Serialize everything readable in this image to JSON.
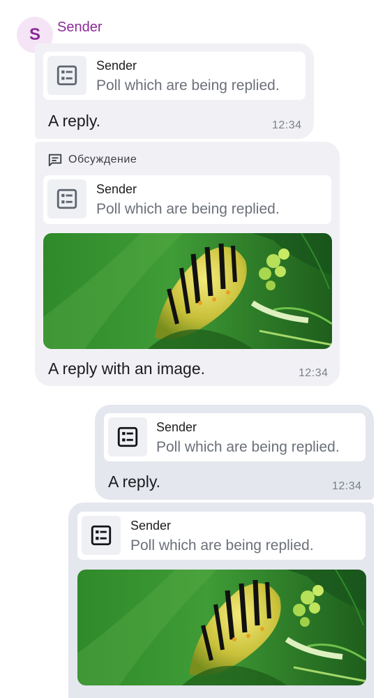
{
  "avatar": {
    "initial": "S",
    "color": "#8a2a97",
    "background": "#f5e4f6"
  },
  "sender": {
    "name": "Sender"
  },
  "thread": {
    "label": "Обсуждение",
    "icon": "comment-icon"
  },
  "messages": [
    {
      "direction": "incoming",
      "reply": {
        "sender": "Sender",
        "text": "Poll which are being replied.",
        "icon": "poll-icon"
      },
      "text": "A reply.",
      "time": "12:34"
    },
    {
      "direction": "incoming",
      "reply": {
        "sender": "Sender",
        "text": "Poll which are being replied.",
        "icon": "poll-icon"
      },
      "image": "caterpillar-photo",
      "text": "A reply with an image.",
      "time": "12:34"
    },
    {
      "direction": "outgoing",
      "reply": {
        "sender": "Sender",
        "text": "Poll which are being replied.",
        "icon": "poll-icon"
      },
      "text": "A reply.",
      "time": "12:34"
    },
    {
      "direction": "outgoing",
      "reply": {
        "sender": "Sender",
        "text": "Poll which are being replied.",
        "icon": "poll-icon"
      },
      "image": "caterpillar-photo"
    }
  ],
  "colors": {
    "incoming_bubble": "#f1f1f5",
    "outgoing_bubble": "#e4e7ee",
    "sender_name": "#8a2a97"
  }
}
